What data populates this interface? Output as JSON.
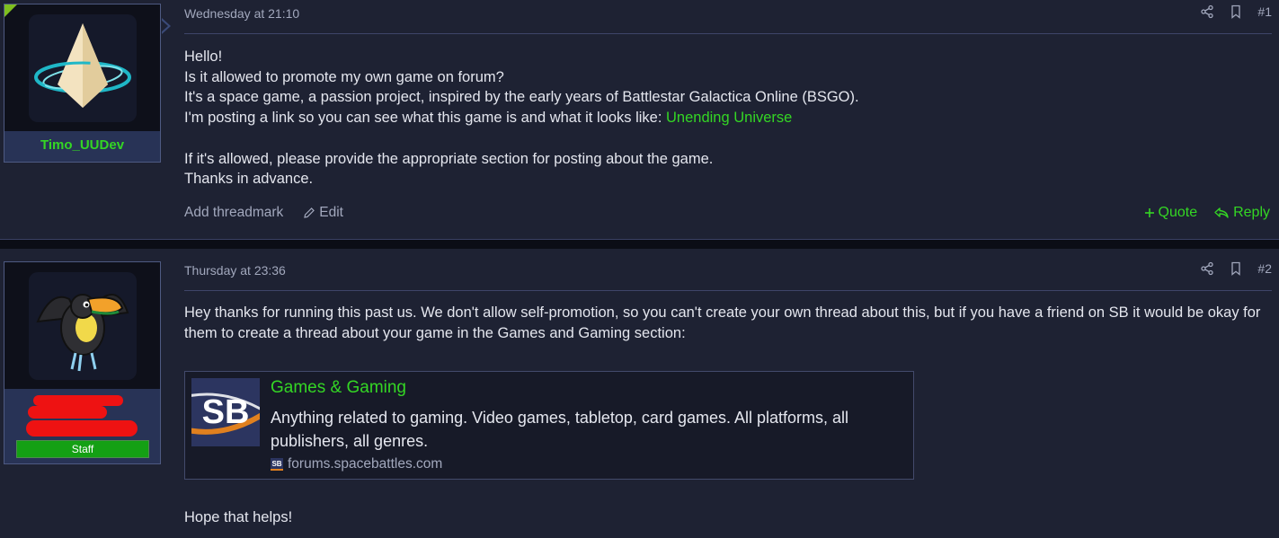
{
  "posts": [
    {
      "username": "Timo_UUDev",
      "timestamp": "Wednesday at 21:10",
      "post_number": "#1",
      "lines": [
        "Hello!",
        "Is it allowed to promote my own game on forum?",
        "It's a space game, a passion project, inspired by the early years of Battlestar Galactica Online (BSGO).",
        "I'm posting a link so you can see what this game is and what it looks like: "
      ],
      "link_text": "Unending Universe",
      "lines2": [
        "If it's allowed, please provide the appropriate section for posting about the game.",
        "Thanks in advance."
      ],
      "add_threadmark": "Add threadmark",
      "edit": "Edit",
      "quote": "Quote",
      "reply": "Reply"
    },
    {
      "badge": "Staff",
      "timestamp": "Thursday at 23:36",
      "post_number": "#2",
      "text": "Hey thanks for running this past us. We don't allow self-promotion, so you can't create your own thread about this, but if you have a friend on SB it would be okay for them to create a thread about your game in the Games and Gaming section:",
      "embed": {
        "logo_text": "SB",
        "title": "Games & Gaming",
        "description": "Anything related to gaming. Video games, tabletop, card games. All platforms, all publishers, all genres.",
        "domain": "forums.spacebattles.com",
        "domain_icon_text": "SB"
      },
      "closing": "Hope that helps!"
    }
  ],
  "colors": {
    "accent_green": "#34d624",
    "background": "#1e2233",
    "muted_text": "#a2a8bd",
    "staff_badge": "#14a014",
    "redaction": "#ee1212"
  },
  "icons": [
    "share-icon",
    "bookmark-icon",
    "pencil-icon",
    "plus-icon",
    "reply-icon"
  ]
}
